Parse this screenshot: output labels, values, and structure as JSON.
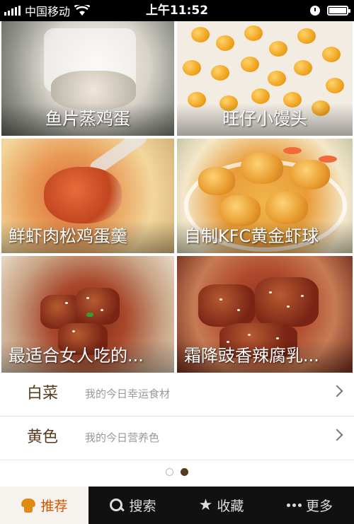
{
  "status_bar": {
    "carrier": "中国移动",
    "time": "上午11:52"
  },
  "recipes": [
    {
      "title": "鱼片蒸鸡蛋"
    },
    {
      "title": "旺仔小馒头"
    },
    {
      "title": "鲜虾肉松鸡蛋羹"
    },
    {
      "title": "自制KFC黄金虾球"
    },
    {
      "title": "最适合女人吃的..."
    },
    {
      "title": "霜降豉香辣腐乳..."
    }
  ],
  "rows": [
    {
      "label": "白菜",
      "desc": "我的今日幸运食材"
    },
    {
      "label": "黄色",
      "desc": "我的今日营养色"
    }
  ],
  "pager": {
    "count": 2,
    "active": 2
  },
  "tabs": [
    {
      "label": "推荐",
      "icon": "chef-hat-icon",
      "active": true
    },
    {
      "label": "搜索",
      "icon": "search-icon",
      "active": false
    },
    {
      "label": "收藏",
      "icon": "star-icon",
      "active": false
    },
    {
      "label": "更多",
      "icon": "more-dots-icon",
      "active": false
    }
  ],
  "colors": {
    "accent": "#d35400",
    "label_brown": "#5a3a1d",
    "tabbar_bg": "#111111"
  }
}
